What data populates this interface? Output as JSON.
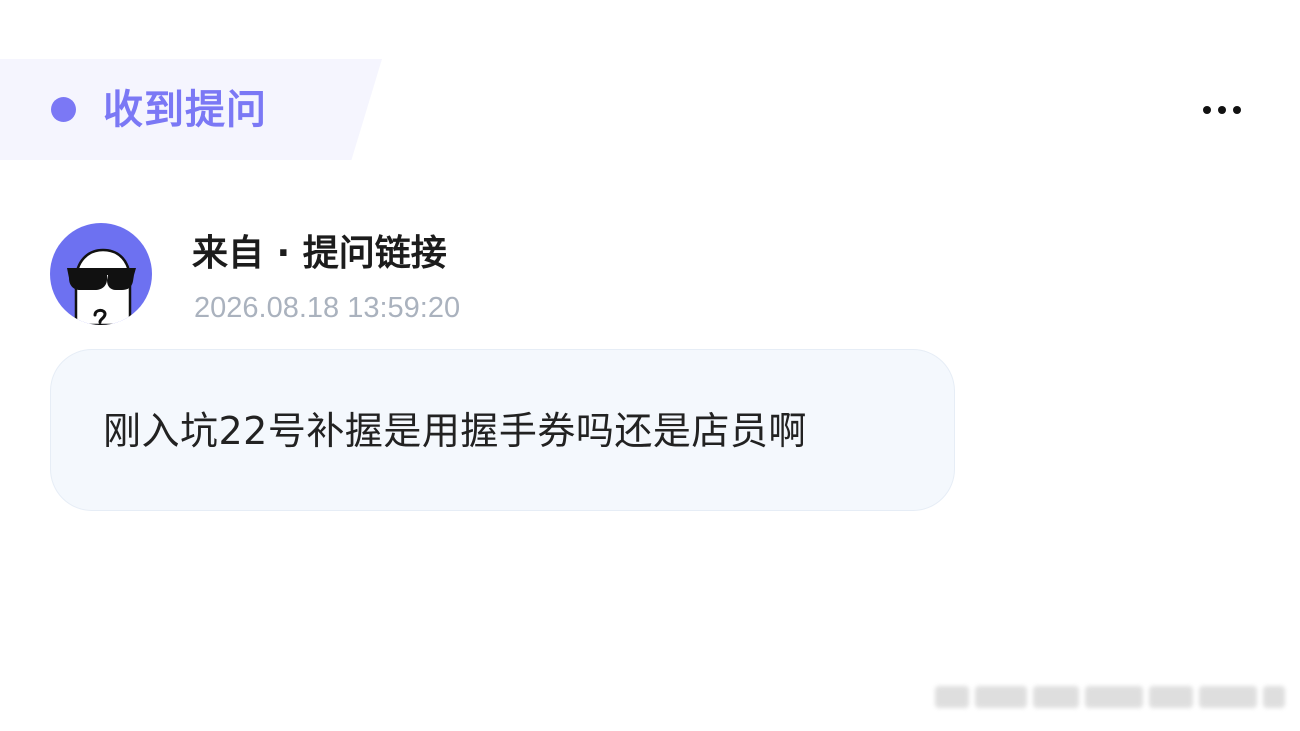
{
  "header": {
    "title": "收到提问",
    "more_icon": "more-horizontal-icon",
    "accent_color": "#7b78f5"
  },
  "question_card": {
    "avatar_icon": "sunglasses-ghost-avatar",
    "avatar_color": "#6d71f1",
    "sender": "来自 · 提问链接",
    "timestamp": "2026.08.18 13:59:20",
    "question_text": "刚入坑22号补握是用握手券吗还是店员啊"
  }
}
